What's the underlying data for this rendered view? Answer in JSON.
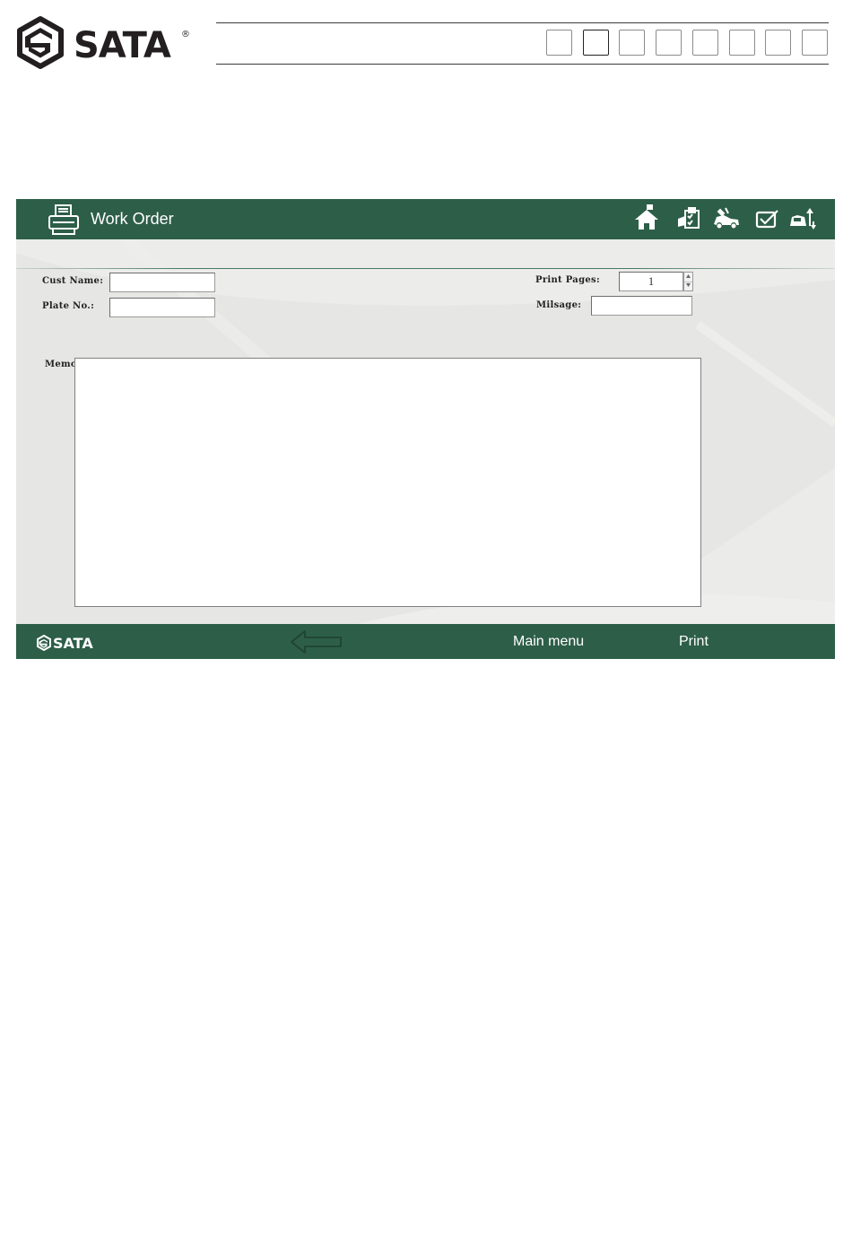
{
  "brand": {
    "name": "SATA",
    "registered_mark": "®",
    "color": "#231f20"
  },
  "page_indicator": {
    "count": 8,
    "active_index": 1
  },
  "window": {
    "title": "Work Order",
    "title_icon": "printer-icon",
    "toolbar": [
      {
        "name": "home-icon",
        "label": "Home"
      },
      {
        "name": "clipboard-check-icon",
        "label": "Inspection"
      },
      {
        "name": "car-repair-icon",
        "label": "Repair"
      },
      {
        "name": "checkmark-icon",
        "label": "Confirm"
      },
      {
        "name": "car-sort-icon",
        "label": "Sort"
      }
    ],
    "colors": {
      "bar": "#2d5e48",
      "panel": "#e6e6e4"
    }
  },
  "form": {
    "cust_name": {
      "label": "Cust Name:",
      "value": ""
    },
    "plate_no": {
      "label": "Plate No.:",
      "value": ""
    },
    "print_pages": {
      "label": "Print Pages:",
      "value": "1"
    },
    "milsage": {
      "label": "Milsage:",
      "value": ""
    },
    "memo": {
      "label": "Memo.",
      "value": ""
    }
  },
  "footer": {
    "logo": "SATA",
    "back_icon": "arrow-left-icon",
    "main_menu": "Main menu",
    "print": "Print"
  }
}
